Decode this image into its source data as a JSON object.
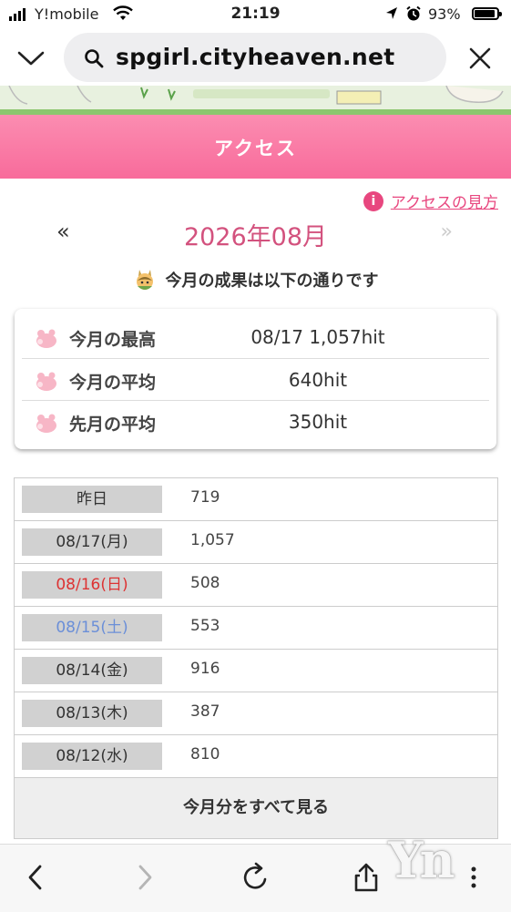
{
  "status_bar": {
    "carrier": "Y!mobile",
    "time": "21:19",
    "battery_percent": "93%",
    "battery_level": 0.93
  },
  "url_bar": {
    "url": "spgirl.cityheaven.net"
  },
  "access": {
    "header_title": "アクセス",
    "help_icon": "i",
    "help_link": "アクセスの見方",
    "prev_symbol": "«",
    "month_title": "2026年08月",
    "next_symbol": "»",
    "results_text": "今月の成果は以下の通りです"
  },
  "stats": [
    {
      "label": "今月の最高",
      "value": "08/17 1,057hit"
    },
    {
      "label": "今月の平均",
      "value": "640hit"
    },
    {
      "label": "先月の平均",
      "value": "350hit"
    }
  ],
  "daily": [
    {
      "date": "昨日",
      "hits": "719",
      "kind": "normal"
    },
    {
      "date": "08/17(月)",
      "hits": "1,057",
      "kind": "normal"
    },
    {
      "date": "08/16(日)",
      "hits": "508",
      "kind": "sun"
    },
    {
      "date": "08/15(土)",
      "hits": "553",
      "kind": "sat"
    },
    {
      "date": "08/14(金)",
      "hits": "916",
      "kind": "normal"
    },
    {
      "date": "08/13(木)",
      "hits": "387",
      "kind": "normal"
    },
    {
      "date": "08/12(水)",
      "hits": "810",
      "kind": "normal"
    }
  ],
  "view_all_label": "今月分をすべて見る",
  "watermark": "Yn",
  "colors": {
    "accent_pink": "#e8477f",
    "header_pink": "#f86b9b",
    "sunday_red": "#dd3333",
    "saturday_blue": "#6b8fd8"
  },
  "icons": {
    "status": [
      "signal-icon",
      "wifi-icon",
      "location-icon",
      "alarm-icon",
      "battery-icon"
    ],
    "url_bar": [
      "chevron-down-icon",
      "search-icon",
      "close-icon"
    ],
    "toolbar": [
      "back-icon",
      "forward-icon",
      "reload-icon",
      "share-icon",
      "more-icon"
    ]
  }
}
